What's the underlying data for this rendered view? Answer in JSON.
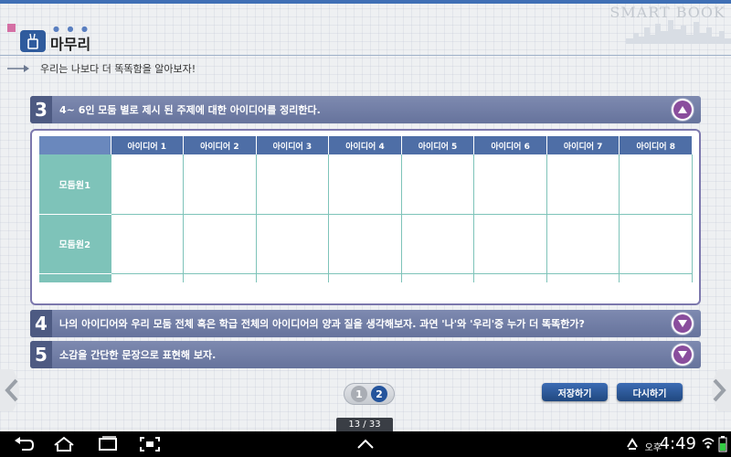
{
  "brand": "SMART BOOK",
  "section_title": "마무리",
  "intro": "우리는 나보다 더 똑똑함을 알아보자!",
  "steps": [
    {
      "num": "3",
      "text": "4~ 6인 모둠 별로 제시 된 주제에 대한 아이디어를 정리한다.",
      "toggle_icon": "chevron-up-icon"
    },
    {
      "num": "4",
      "text": "나의 아이디어와 우리 모둠 전체 혹은 학급 전체의 아이디어의 양과 질을 생각해보자. 과연 '나'와 '우리'중 누가 더 똑똑한가?",
      "toggle_icon": "chevron-down-icon"
    },
    {
      "num": "5",
      "text": "소감을 간단한 문장으로 표현해 보자.",
      "toggle_icon": "chevron-down-icon"
    }
  ],
  "table": {
    "columns": [
      "아이디어 1",
      "아이디어 2",
      "아이디어 3",
      "아이디어 4",
      "아이디어 5",
      "아이디어 6",
      "아이디어 7",
      "아이디어 8"
    ],
    "rows": [
      "모둠원1",
      "모둠원2"
    ]
  },
  "pager": {
    "pages": [
      "1",
      "2"
    ],
    "current": "2"
  },
  "buttons": {
    "save": "저장하기",
    "retry": "다시하기"
  },
  "page_counter": "13 / 33",
  "system": {
    "ampm": "오후",
    "time": "4:49"
  },
  "colors": {
    "step_bar": "#6f7ba3",
    "table_header": "#4e6ea6",
    "row_header": "#7ec3b9",
    "button": "#2a5697"
  }
}
